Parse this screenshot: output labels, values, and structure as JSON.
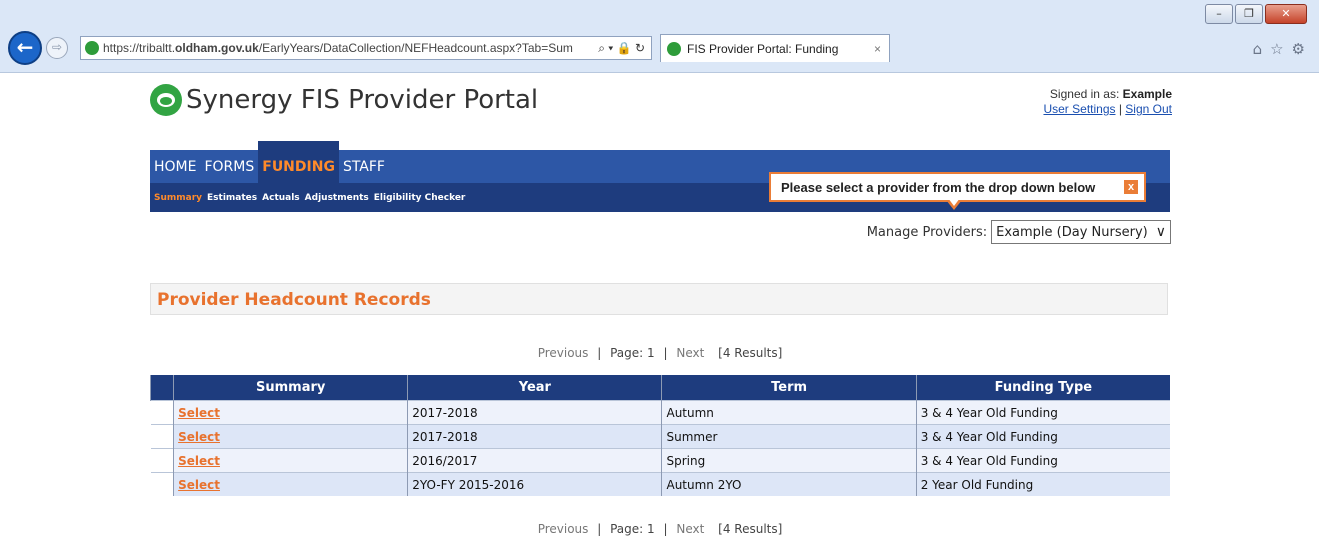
{
  "browser": {
    "url_prefix": "https://tribaltt.",
    "url_domain": "oldham.gov.uk",
    "url_path": "/EarlyYears/DataCollection/NEFHeadcount.aspx?Tab=Sum",
    "url_tools": "⌕ ▾ 🔒 ↻",
    "tab_title": "FIS Provider Portal: Funding",
    "tab_close": "×",
    "window_min": "–",
    "window_max": "❐",
    "window_close": "✕",
    "back": "←",
    "forward": "⇨",
    "home_icon": "⌂",
    "favorites_icon": "☆",
    "settings_icon": "⚙"
  },
  "header": {
    "app_title": "Synergy FIS Provider Portal",
    "signed_in_prefix": "Signed in as: ",
    "signed_in_user": "Example",
    "user_settings": "User Settings",
    "separator": " | ",
    "sign_out": "Sign Out"
  },
  "nav": {
    "items": [
      {
        "label": "HOME",
        "active": false
      },
      {
        "label": "FORMS",
        "active": false
      },
      {
        "label": "FUNDING",
        "active": true
      },
      {
        "label": "STAFF",
        "active": false
      }
    ],
    "sub_items": [
      {
        "label": "Summary",
        "active": true
      },
      {
        "label": "Estimates",
        "active": false
      },
      {
        "label": "Actuals",
        "active": false
      },
      {
        "label": "Adjustments",
        "active": false
      },
      {
        "label": "Eligibility Checker",
        "active": false
      }
    ]
  },
  "tooltip": {
    "message": "Please select a provider from the drop down below",
    "close": "x"
  },
  "manage": {
    "label": "Manage Providers:",
    "selected": "Example (Day Nursery)",
    "chevron": "∨"
  },
  "section": {
    "title": "Provider Headcount Records"
  },
  "pager": {
    "previous": "Previous",
    "sep": "|",
    "page": "Page: 1",
    "next": "Next",
    "results": "[4 Results]"
  },
  "table": {
    "headers": [
      "Summary",
      "Year",
      "Term",
      "Funding Type"
    ],
    "rows": [
      {
        "select": "Select",
        "year": "2017-2018",
        "term": "Autumn",
        "funding": "3 & 4 Year Old Funding"
      },
      {
        "select": "Select",
        "year": "2017-2018",
        "term": "Summer",
        "funding": "3 & 4 Year Old Funding"
      },
      {
        "select": "Select",
        "year": "2016/2017",
        "term": "Spring",
        "funding": "3 & 4 Year Old Funding"
      },
      {
        "select": "Select",
        "year": "2YO-FY 2015-2016",
        "term": "Autumn 2YO",
        "funding": "2 Year Old Funding"
      }
    ]
  },
  "colors": {
    "accent": "#e8722e",
    "nav_primary": "#2d57a6",
    "nav_dark": "#1e3c7e",
    "brand_green": "#32a443"
  }
}
